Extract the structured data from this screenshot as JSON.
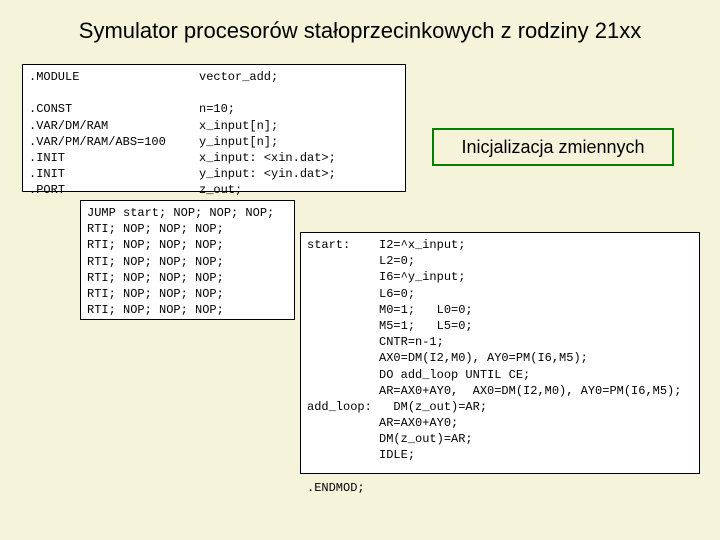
{
  "title": "Symulator procesorów stałoprzecinkowych z rodziny 21xx",
  "label": "Inicjalizacja zmiennych",
  "box1": {
    "left": ".MODULE\n\n.CONST\n.VAR/DM/RAM\n.VAR/PM/RAM/ABS=100\n.INIT\n.INIT\n.PORT",
    "right": "vector_add;\n\nn=10;\nx_input[n];\ny_input[n];\nx_input: <xin.dat>;\ny_input: <yin.dat>;\nz_out;"
  },
  "box2": "JUMP start; NOP; NOP; NOP;\nRTI; NOP; NOP; NOP;\nRTI; NOP; NOP; NOP;\nRTI; NOP; NOP; NOP;\nRTI; NOP; NOP; NOP;\nRTI; NOP; NOP; NOP;\nRTI; NOP; NOP; NOP;",
  "box3": "start:    I2=^x_input;\n          L2=0;\n          I6=^y_input;\n          L6=0;\n          M0=1;   L0=0;\n          M5=1;   L5=0;\n          CNTR=n-1;\n          AX0=DM(I2,M0), AY0=PM(I6,M5);\n          DO add_loop UNTIL CE;\n          AR=AX0+AY0,  AX0=DM(I2,M0), AY0=PM(I6,M5);\nadd_loop:   DM(z_out)=AR;\n          AR=AX0+AY0;\n          DM(z_out)=AR;\n          IDLE;\n\n.ENDMOD;"
}
